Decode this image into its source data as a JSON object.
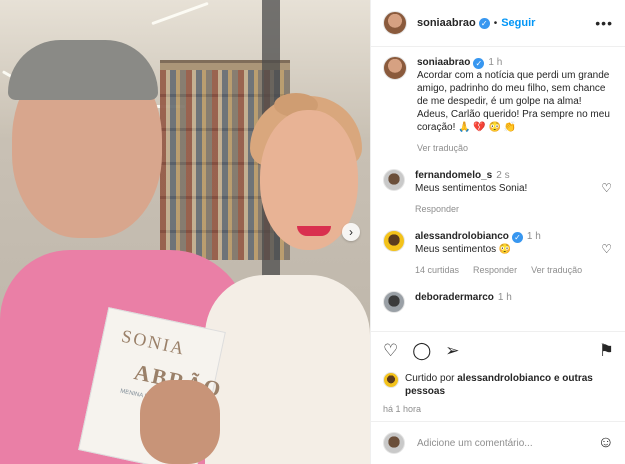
{
  "post": {
    "username": "soniaabrao",
    "follow_label": "Seguir",
    "more_label": "•••",
    "caption": {
      "time": "1 h",
      "text": "Acordar com a notícia que perdi um grande amigo, padrinho do meu filho, sem chance de me despedir, é um golpe na alma! Adeus, Carlão querido! Pra sempre no meu coração! 🙏 💔 😳 👏",
      "translate_label": "Ver tradução"
    },
    "book": {
      "title_line1": "SONIA",
      "title_line2": "ABRÃO",
      "subtitle": "MENINA DOS MEUS"
    }
  },
  "comments": [
    {
      "username": "fernandomelo_s",
      "time": "2 s",
      "text": "Meus sentimentos Sonia!",
      "reply_label": "Responder"
    },
    {
      "username": "alessandrolobianco",
      "time": "1 h",
      "text": "Meus sentimentos 😳",
      "likes_label": "14 curtidas",
      "reply_label": "Responder",
      "translate_label": "Ver tradução"
    },
    {
      "username": "deboradermarco",
      "time": "1 h"
    }
  ],
  "actions": {
    "liked_text_prefix": "Curtido por",
    "liked_user": "alessandrolobianco",
    "liked_text_suffix": "e outras pessoas",
    "posted_ago": "há 1 hora"
  },
  "add_comment": {
    "placeholder": "Adicione um comentário..."
  },
  "colors": {
    "accent": "#0095f6",
    "verified": "#3897f0",
    "muted": "#8e8e8e"
  }
}
